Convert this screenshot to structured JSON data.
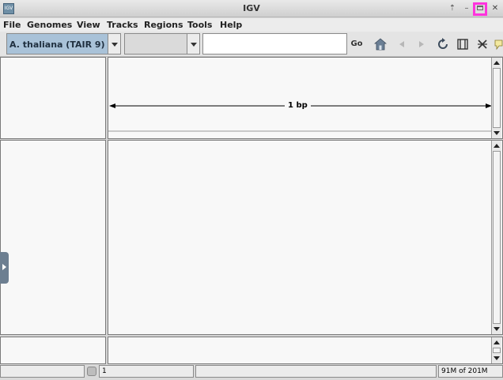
{
  "window": {
    "title": "IGV"
  },
  "menu": [
    {
      "id": "file",
      "label": "File"
    },
    {
      "id": "genomes",
      "label": "Genomes"
    },
    {
      "id": "view",
      "label": "View"
    },
    {
      "id": "tracks",
      "label": "Tracks"
    },
    {
      "id": "regions",
      "label": "Regions"
    },
    {
      "id": "tools",
      "label": "Tools"
    },
    {
      "id": "help",
      "label": "Help"
    }
  ],
  "toolbar": {
    "genome_selected": "A. thaliana (TAIR 9)",
    "chromosome_selected": "",
    "locus_value": "",
    "go_label": "Go",
    "icons": [
      "home-icon",
      "back-icon",
      "forward-icon",
      "refresh-icon",
      "region-of-interest-icon",
      "resize-icon",
      "popup-info-icon"
    ]
  },
  "ruler": {
    "span_label": "1 bp"
  },
  "status": {
    "position": "",
    "locus": "1",
    "message": "",
    "memory": "91M of 201M"
  },
  "colors": {
    "highlight": "#ff33dd",
    "genome_combo": "#a9c2d8"
  }
}
